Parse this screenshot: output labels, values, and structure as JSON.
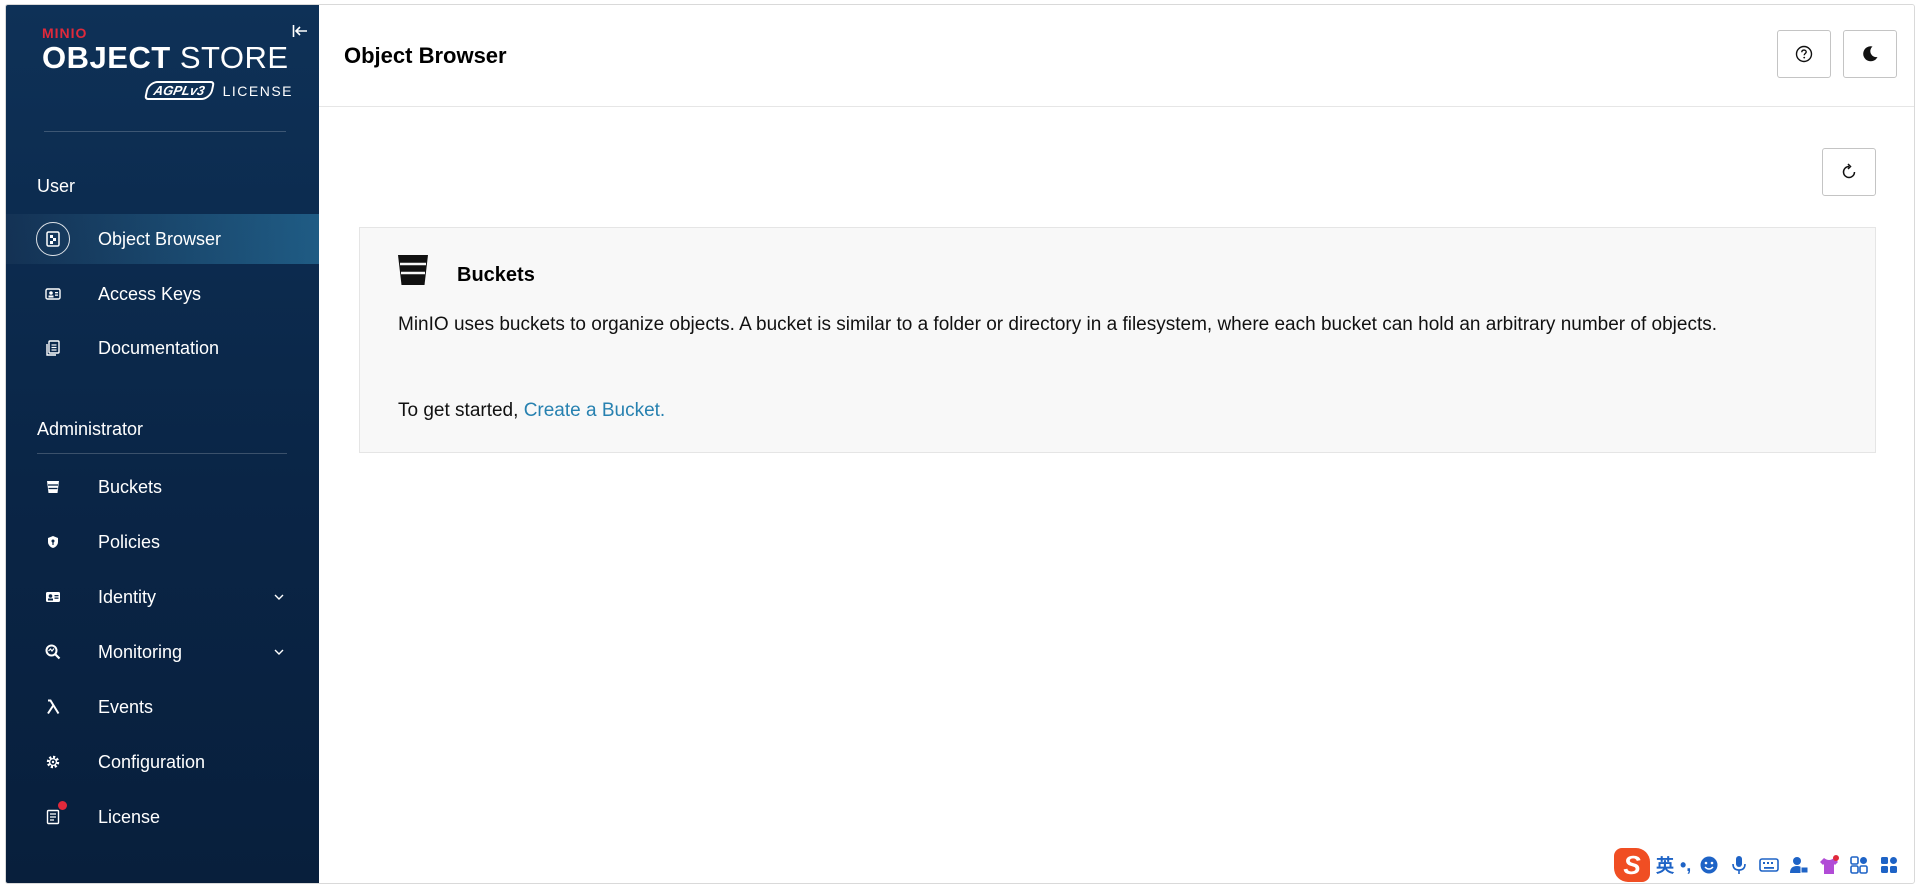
{
  "brand": {
    "minio": "MINIO",
    "object": "OBJECT",
    "store": "STORE",
    "agpl": "AGPLv3",
    "license": "LICENSE"
  },
  "sidebar": {
    "user_section": "User",
    "admin_section": "Administrator",
    "user_items": [
      {
        "label": "Object Browser",
        "icon": "object-browser-icon",
        "active": true
      },
      {
        "label": "Access Keys",
        "icon": "access-keys-icon"
      },
      {
        "label": "Documentation",
        "icon": "documentation-icon"
      }
    ],
    "admin_items": [
      {
        "label": "Buckets",
        "icon": "bucket-icon"
      },
      {
        "label": "Policies",
        "icon": "shield-icon"
      },
      {
        "label": "Identity",
        "icon": "identity-icon",
        "expandable": true
      },
      {
        "label": "Monitoring",
        "icon": "monitoring-icon",
        "expandable": true
      },
      {
        "label": "Events",
        "icon": "lambda-icon"
      },
      {
        "label": "Configuration",
        "icon": "gear-icon"
      },
      {
        "label": "License",
        "icon": "license-icon",
        "notification": true
      }
    ]
  },
  "header": {
    "title": "Object Browser"
  },
  "buckets_info": {
    "title": "Buckets",
    "description": "MinIO uses buckets to organize objects. A bucket is similar to a folder or directory in a filesystem, where each bucket can hold an arbitrary number of objects.",
    "start_text": "To get started,",
    "create_link": "Create a Bucket."
  },
  "ime": {
    "logo": "S",
    "lang": "英",
    "punct": "•,"
  },
  "colors": {
    "sidebar_bg": "#0a2546",
    "accent": "#2781b0",
    "notification": "#e0293b"
  }
}
